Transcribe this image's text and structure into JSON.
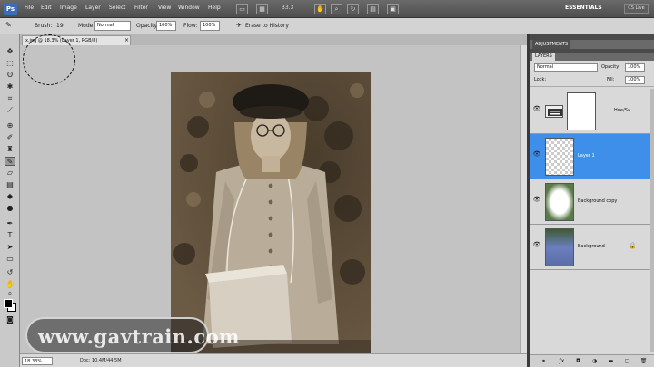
{
  "menubar": {
    "logo": "Ps",
    "menus": [
      "File",
      "Edit",
      "Image",
      "Layer",
      "Select",
      "Filter",
      "View",
      "Window",
      "Help"
    ],
    "zoom": "33.3",
    "workspace": "ESSENTIALS",
    "cs_live": "CS Live"
  },
  "options": {
    "brush_label": "Brush:",
    "brush_size": "19",
    "mode_label": "Mode:",
    "mode_value": "Normal",
    "opacity_label": "Opacity:",
    "opacity_value": "100%",
    "flow_label": "Flow:",
    "flow_value": "100%",
    "history_label": "Erase to History"
  },
  "document": {
    "tab_title": "x.jpg @ 18.3% (Layer 1, RGB/8)",
    "zoom_status": "18.33%",
    "doc_status": "Doc: 10.4M/44.5M"
  },
  "watermark": "www.gavtrain.com",
  "panels": {
    "top_tab": "ADJUSTMENTS",
    "layers_tab": "LAYERS",
    "blend_mode": "Normal",
    "opacity_label": "Opacity:",
    "opacity_value": "100%",
    "lock_label": "Lock:",
    "fill_label": "Fill:",
    "fill_value": "100%",
    "layers": [
      {
        "name": "Hue/Sa...",
        "selected": false
      },
      {
        "name": "Layer 1",
        "selected": true
      },
      {
        "name": "Background copy",
        "selected": false
      },
      {
        "name": "Background",
        "selected": false
      }
    ]
  }
}
